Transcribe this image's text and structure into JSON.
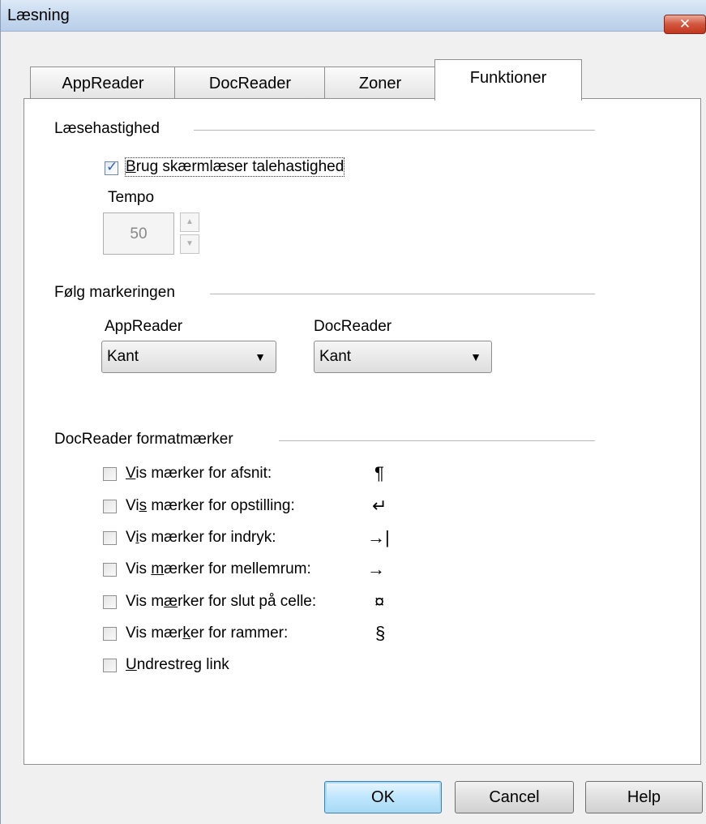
{
  "window": {
    "title": "Læsning",
    "close_glyph": "✕"
  },
  "tabs": [
    {
      "label": "AppReader",
      "active": false
    },
    {
      "label": "DocReader",
      "active": false
    },
    {
      "label": "Zoner",
      "active": false
    },
    {
      "label": "Funktioner",
      "active": true
    }
  ],
  "reading_speed": {
    "group_title": "Læsehastighed",
    "use_screenreader_speed": {
      "label_accel": "B",
      "label_rest": "rug skærmlæser talehastighed",
      "checked": true
    },
    "tempo_label": "Tempo",
    "tempo_value": "50",
    "spin_up": "▲",
    "spin_down": "▼"
  },
  "follow_selection": {
    "group_title": "Følg markeringen",
    "appreader_label": "AppReader",
    "appreader_value": "Kant",
    "docreader_label": "DocReader",
    "docreader_value": "Kant",
    "dropdown_glyph": "▼"
  },
  "format_marks": {
    "group_title": "DocReader formatmærker",
    "items": [
      {
        "pre": "",
        "accel": "V",
        "post": "is mærker for afsnit:",
        "mark": "¶",
        "checked": false
      },
      {
        "pre": "Vi",
        "accel": "s",
        "post": " mærker for opstilling:",
        "mark": "↵",
        "checked": false
      },
      {
        "pre": "V",
        "accel": "i",
        "post": "s mærker for indryk:",
        "mark": "→|",
        "checked": false
      },
      {
        "pre": "Vis ",
        "accel": "m",
        "post": "ærker for mellemrum:",
        "mark": "→",
        "checked": false
      },
      {
        "pre": "Vis m",
        "accel": "æ",
        "post": "rker for slut på celle:",
        "mark": "¤",
        "checked": false
      },
      {
        "pre": "Vis mær",
        "accel": "k",
        "post": "er for rammer:",
        "mark": "§",
        "checked": false
      },
      {
        "pre": "",
        "accel": "U",
        "post": "ndrestreg link",
        "mark": "",
        "checked": false
      }
    ]
  },
  "buttons": {
    "ok": "OK",
    "cancel": "Cancel",
    "help": "Help"
  }
}
